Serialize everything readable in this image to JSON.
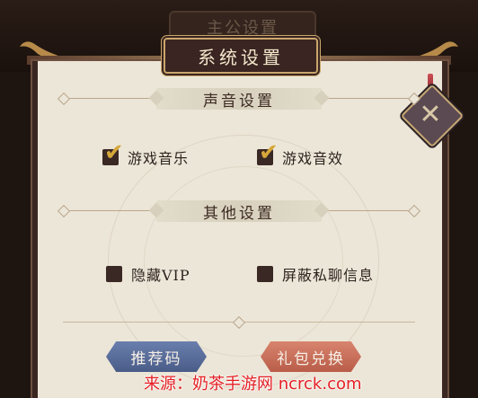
{
  "background": {
    "panel_title": "主公设置"
  },
  "dialog": {
    "title": "系统设置",
    "sections": {
      "sound": {
        "title": "声音设置",
        "options": [
          {
            "label": "游戏音乐",
            "checked": true
          },
          {
            "label": "游戏音效",
            "checked": true
          }
        ]
      },
      "other": {
        "title": "其他设置",
        "options": [
          {
            "label": "隐藏VIP",
            "checked": false
          },
          {
            "label": "屏蔽私聊信息",
            "checked": false
          }
        ]
      }
    },
    "buttons": {
      "recommend_code": "推荐码",
      "gift_redeem": "礼包兑换"
    }
  },
  "watermark": "来源：奶茶手游网 ncrck.com",
  "icons": {
    "close": "close-icon",
    "check": "check-icon"
  },
  "colors": {
    "panel_bg": "#ece6d8",
    "accent_gold": "#c9a66b",
    "check_gold": "#d6a73a",
    "btn_blue": "#5a6e9c",
    "btn_red": "#c96f59"
  }
}
